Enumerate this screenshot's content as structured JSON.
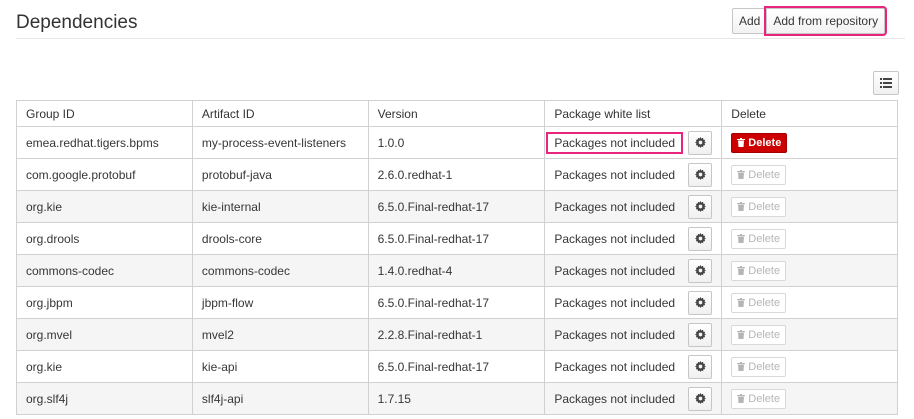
{
  "header": {
    "title": "Dependencies",
    "add_label": "Add",
    "add_repo_label": "Add from repository"
  },
  "table": {
    "columns": [
      "Group ID",
      "Artifact ID",
      "Version",
      "Package white list",
      "Delete"
    ],
    "delete_label": "Delete",
    "rows": [
      {
        "group": "emea.redhat.tigers.bpms",
        "artifact": "my-process-event-listeners",
        "version": "1.0.0",
        "packages": "Packages not included",
        "delete_enabled": true
      },
      {
        "group": "com.google.protobuf",
        "artifact": "protobuf-java",
        "version": "2.6.0.redhat-1",
        "packages": "Packages not included",
        "delete_enabled": false
      },
      {
        "group": "org.kie",
        "artifact": "kie-internal",
        "version": "6.5.0.Final-redhat-17",
        "packages": "Packages not included",
        "delete_enabled": false
      },
      {
        "group": "org.drools",
        "artifact": "drools-core",
        "version": "6.5.0.Final-redhat-17",
        "packages": "Packages not included",
        "delete_enabled": false
      },
      {
        "group": "commons-codec",
        "artifact": "commons-codec",
        "version": "1.4.0.redhat-4",
        "packages": "Packages not included",
        "delete_enabled": false
      },
      {
        "group": "org.jbpm",
        "artifact": "jbpm-flow",
        "version": "6.5.0.Final-redhat-17",
        "packages": "Packages not included",
        "delete_enabled": false
      },
      {
        "group": "org.mvel",
        "artifact": "mvel2",
        "version": "2.2.8.Final-redhat-1",
        "packages": "Packages not included",
        "delete_enabled": false
      },
      {
        "group": "org.kie",
        "artifact": "kie-api",
        "version": "6.5.0.Final-redhat-17",
        "packages": "Packages not included",
        "delete_enabled": false
      },
      {
        "group": "org.slf4j",
        "artifact": "slf4j-api",
        "version": "1.7.15",
        "packages": "Packages not included",
        "delete_enabled": false
      }
    ]
  },
  "icons": {
    "gear": "gear-icon",
    "trash": "trash-icon",
    "list": "list-icon"
  },
  "colors": {
    "highlight": "#e9247d",
    "delete_active": "#cc0000"
  }
}
